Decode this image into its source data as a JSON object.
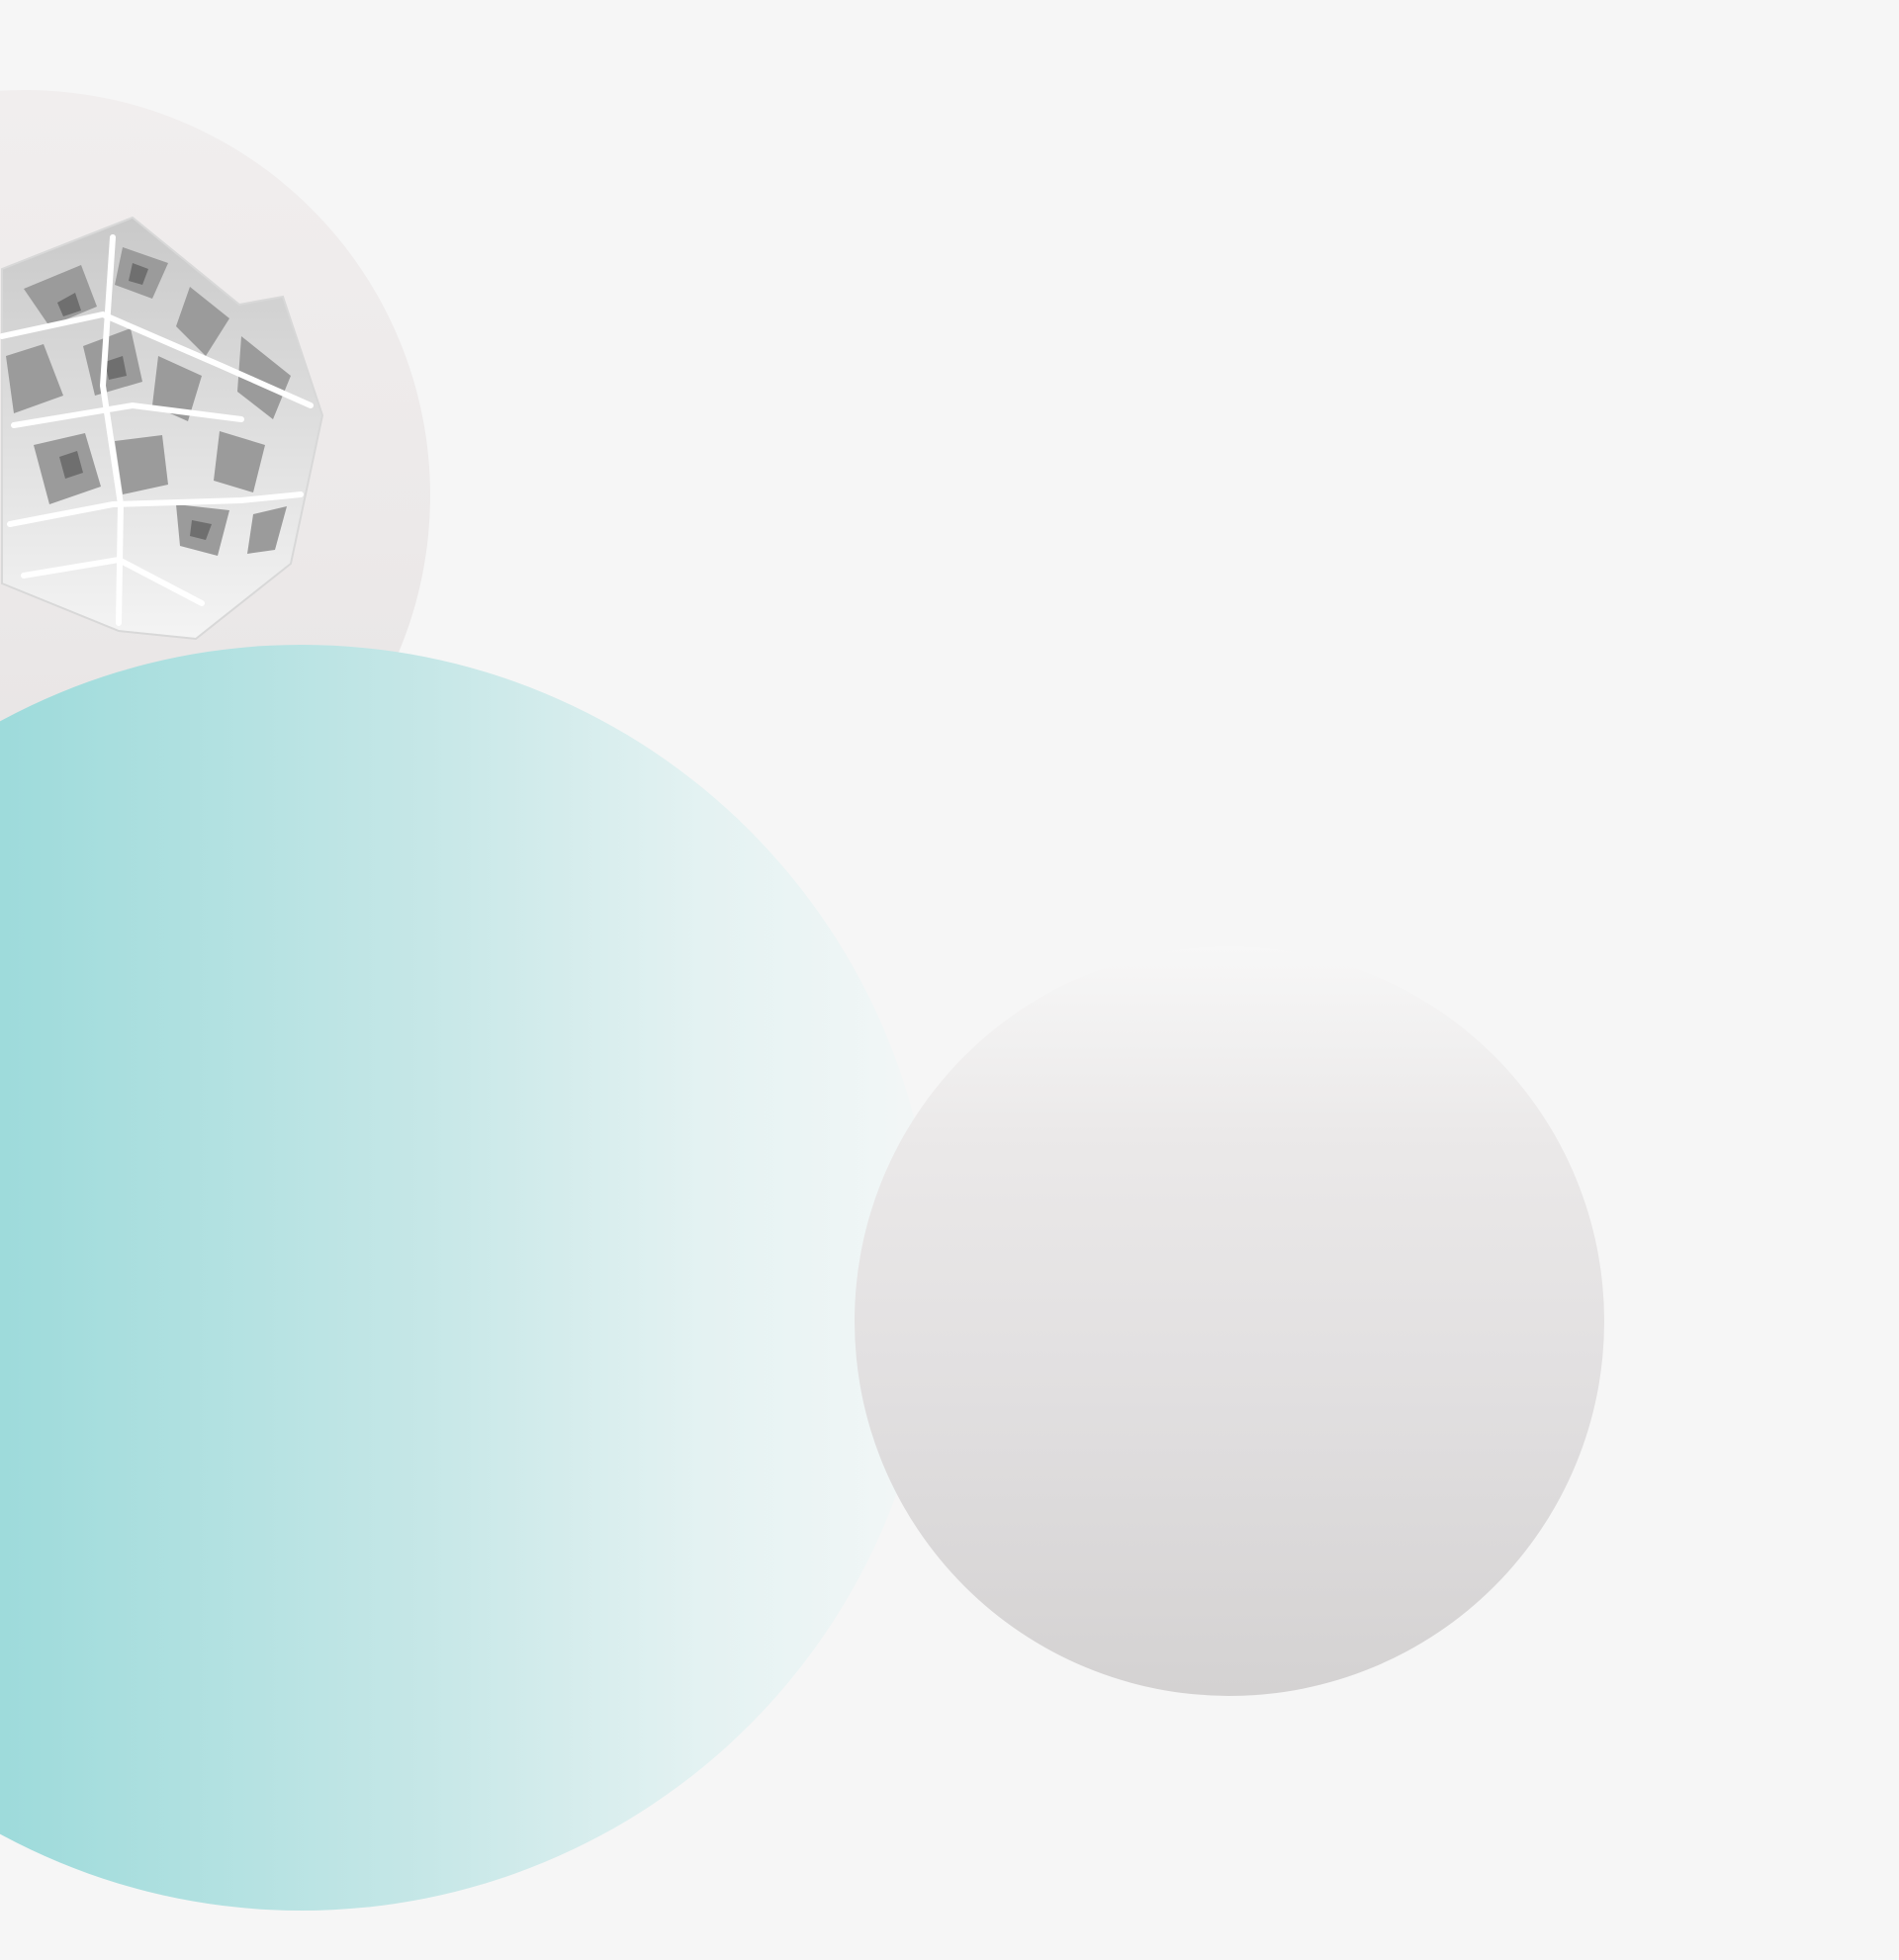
{
  "scene": {
    "background_color": "#f6f6f6",
    "shapes": [
      {
        "name": "light-grey-disc",
        "color": "#eeebeb"
      },
      {
        "name": "teal-gradient-disc",
        "color_start": "#7fd1d2",
        "color_end": "#f4f7f7"
      },
      {
        "name": "grey-gradient-disc",
        "color_start": "#f7f7f7",
        "color_end": "#d4d2d2"
      }
    ],
    "object": {
      "name": "white-lattice-polyhedron-illustration"
    }
  }
}
